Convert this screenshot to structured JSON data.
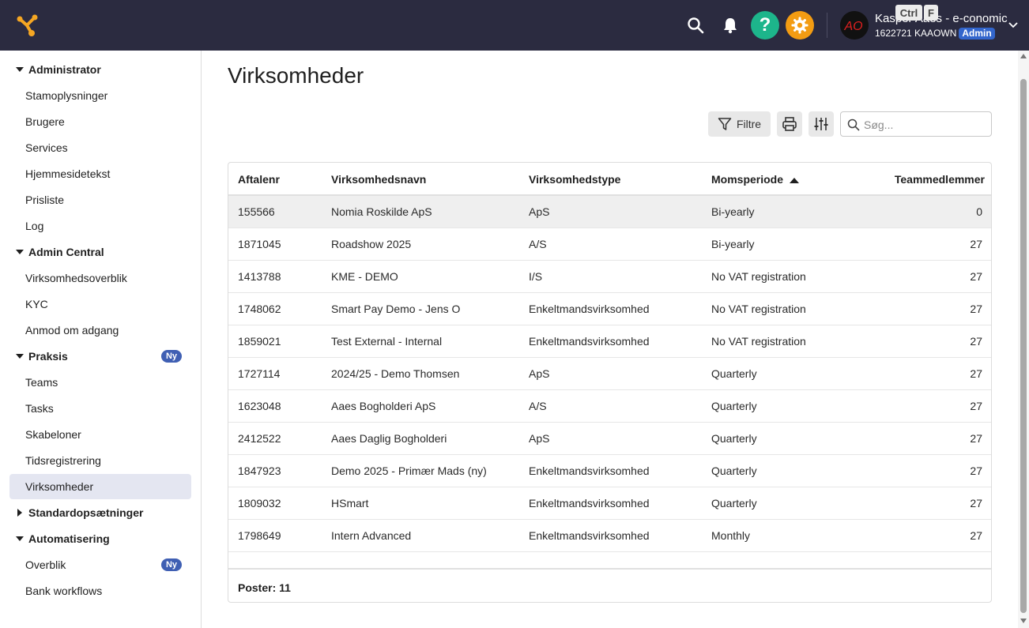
{
  "header": {
    "user_name": "Kasper Aaes - e-conomic",
    "user_id": "1622721 KAAOWN",
    "role_badge": "Admin",
    "avatar_initials": "AO",
    "help_glyph": "?"
  },
  "colors": {
    "topbar": "#2b2b40",
    "help_button": "#1db58b",
    "settings_button": "#f39c12",
    "badge": "#3f5fb3",
    "active_nav": "#e4e6f1"
  },
  "sidebar": {
    "sections": [
      {
        "label": "Administrator",
        "expanded": true,
        "items": [
          "Stamoplysninger",
          "Brugere",
          "Services",
          "Hjemmesidetekst",
          "Prisliste",
          "Log"
        ]
      },
      {
        "label": "Admin Central",
        "expanded": true,
        "items": [
          "Virksomhedsoverblik",
          "KYC",
          "Anmod om adgang"
        ]
      },
      {
        "label": "Praksis",
        "expanded": true,
        "badge": "Ny",
        "items": [
          "Teams",
          "Tasks",
          "Skabeloner",
          "Tidsregistrering",
          "Virksomheder"
        ]
      },
      {
        "label": "Standardopsætninger",
        "expanded": false,
        "items": []
      },
      {
        "label": "Automatisering",
        "expanded": true,
        "items": [
          "Overblik",
          "Bank workflows"
        ],
        "item_badges": {
          "Overblik": "Ny"
        }
      }
    ],
    "active_item": "Virksomheder"
  },
  "page": {
    "title": "Virksomheder"
  },
  "toolbar": {
    "filter_label": "Filtre",
    "search_placeholder": "Søg...",
    "shortcut_ctrl": "Ctrl",
    "shortcut_key": "F"
  },
  "table": {
    "columns": [
      "Aftalenr",
      "Virksomhedsnavn",
      "Virksomhedstype",
      "Momsperiode",
      "Teammedlemmer"
    ],
    "sorted_column": "Momsperiode",
    "sort_direction": "ascending",
    "rows": [
      [
        "155566",
        "Nomia Roskilde ApS",
        "ApS",
        "Bi-yearly",
        "0"
      ],
      [
        "1871045",
        "Roadshow 2025",
        "A/S",
        "Bi-yearly",
        "27"
      ],
      [
        "1413788",
        "KME - DEMO",
        "I/S",
        "No VAT registration",
        "27"
      ],
      [
        "1748062",
        "Smart Pay Demo - Jens O",
        "Enkeltmandsvirksomhed",
        "No VAT registration",
        "27"
      ],
      [
        "1859021",
        "Test External - Internal",
        "Enkeltmandsvirksomhed",
        "No VAT registration",
        "27"
      ],
      [
        "1727114",
        "2024/25 - Demo Thomsen",
        "ApS",
        "Quarterly",
        "27"
      ],
      [
        "1623048",
        "Aaes Bogholderi ApS",
        "A/S",
        "Quarterly",
        "27"
      ],
      [
        "2412522",
        "Aaes Daglig Bogholderi",
        "ApS",
        "Quarterly",
        "27"
      ],
      [
        "1847923",
        "Demo 2025 - Primær Mads (ny)",
        "Enkeltmandsvirksomhed",
        "Quarterly",
        "27"
      ],
      [
        "1809032",
        "HSmart",
        "Enkeltmandsvirksomhed",
        "Quarterly",
        "27"
      ],
      [
        "1798649",
        "Intern Advanced",
        "Enkeltmandsvirksomhed",
        "Monthly",
        "27"
      ]
    ],
    "footer": "Poster: 11"
  }
}
